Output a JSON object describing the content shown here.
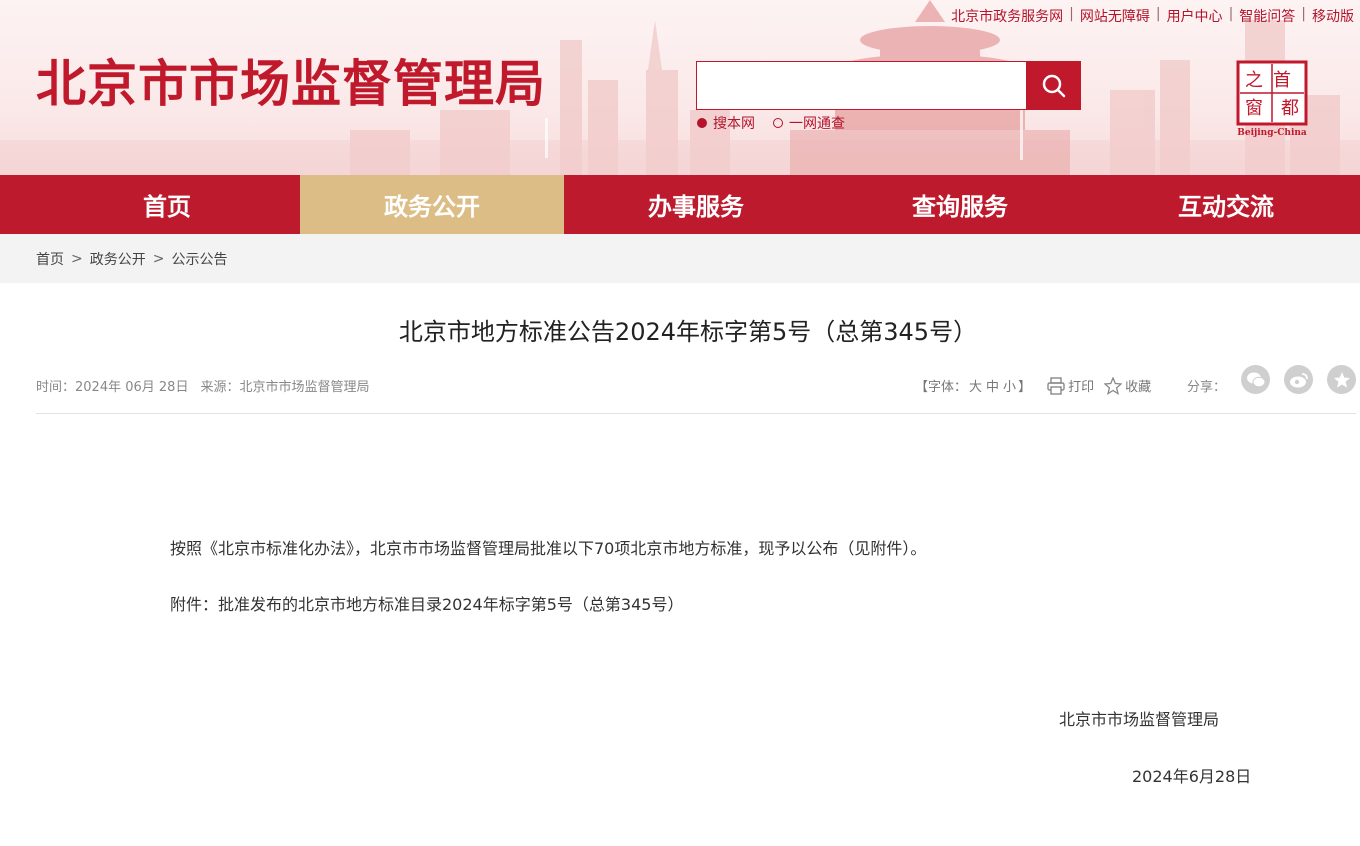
{
  "header": {
    "site_title": "北京市市场监督管理局",
    "top_links": [
      "北京市政务服务网",
      "网站无障碍",
      "用户中心",
      "智能问答",
      "移动版"
    ],
    "search": {
      "placeholder": "",
      "scopes": [
        {
          "label": "搜本网",
          "selected": true
        },
        {
          "label": "一网通查",
          "selected": false
        }
      ]
    },
    "logo": {
      "chars": [
        "首",
        "都",
        "之",
        "窗"
      ],
      "caption": "Beijing-China"
    }
  },
  "nav": {
    "items": [
      {
        "label": "首页",
        "active": false
      },
      {
        "label": "政务公开",
        "active": true
      },
      {
        "label": "办事服务",
        "active": false
      },
      {
        "label": "查询服务",
        "active": false
      },
      {
        "label": "互动交流",
        "active": false
      }
    ]
  },
  "breadcrumb": [
    "首页",
    "政务公开",
    "公示公告"
  ],
  "article": {
    "title": "北京市地方标准公告2024年标字第5号（总第345号）",
    "meta": {
      "time_label": "时间：",
      "time_value": "2024年 06月 28日",
      "source_label": "来源：",
      "source_value": "北京市市场监督管理局"
    },
    "tools": {
      "font_label_open": "【字体：",
      "font_sizes": [
        "大",
        "中",
        "小"
      ],
      "font_label_close": "】",
      "print": "打印",
      "favorite": "收藏",
      "share_label": "分享："
    },
    "paragraphs": [
      "按照《北京市标准化办法》，北京市市场监督管理局批准以下70项北京市地方标准，现予以公布（见附件）。",
      "附件：批准发布的北京市地方标准目录2024年标字第5号（总第345号）"
    ],
    "signature": "北京市市场监督管理局",
    "date": "2024年6月28日"
  },
  "colors": {
    "brand_red": "#be1a2e",
    "active_tab": "#dbbd85",
    "crumb_bg": "#f3f3f3"
  }
}
